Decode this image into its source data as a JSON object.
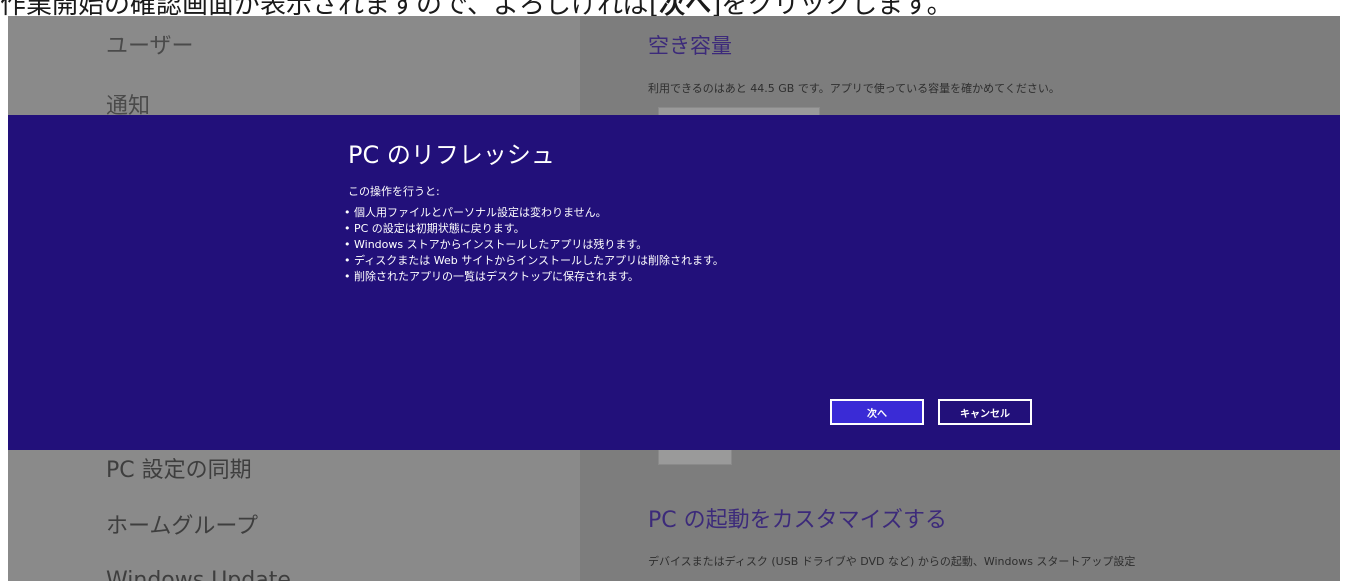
{
  "caption": {
    "before": "作業開始の確認画面が表示されますので、よろしければ[",
    "bold": "次へ",
    "after": "]をクリックします。"
  },
  "settings_nav": {
    "users": "ユーザー",
    "notifications": "通知",
    "pc_sync": "PC 設定の同期",
    "homegroup": "ホームグループ",
    "windows_update": "Windows Update"
  },
  "settings_main": {
    "free_space_title": "空き容量",
    "free_space_text": "利用できるのはあと 44.5 GB です。アプリで使っている容量を確かめてください。",
    "startup_title": "PC の起動をカスタマイズする",
    "startup_text": "デバイスまたはディスク (USB ドライブや DVD など) からの起動、Windows スタートアップ設定"
  },
  "dialog": {
    "title": "PC のリフレッシュ",
    "intro": "この操作を行うと:",
    "items": [
      "個人用ファイルとパーソナル設定は変わりません。",
      "PC の設定は初期状態に戻ります。",
      "Windows ストアからインストールしたアプリは残ります。",
      "ディスクまたは Web サイトからインストールしたアプリは削除されます。",
      "削除されたアプリの一覧はデスクトップに保存されます。"
    ],
    "next_label": "次へ",
    "cancel_label": "キャンセル"
  }
}
